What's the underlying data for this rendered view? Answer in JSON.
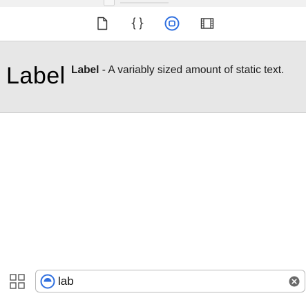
{
  "header": {
    "tabs": [
      {
        "name": "file-inspector",
        "icon": "file-icon",
        "selected": false
      },
      {
        "name": "code-snippet-library",
        "icon": "braces-icon",
        "selected": false
      },
      {
        "name": "object-library",
        "icon": "object-library-icon",
        "selected": true
      },
      {
        "name": "media-library",
        "icon": "film-strip-icon",
        "selected": false
      }
    ],
    "accent_color": "#2f6fdf",
    "icon_color": "#333333"
  },
  "library": {
    "items": [
      {
        "preview_text": "Label",
        "title": "Label",
        "description": " - A variably sized amount of static text."
      }
    ],
    "selected_background": "#e7e7e7"
  },
  "filter_bar": {
    "view_toggle_icon": "grid-view-icon",
    "filter_icon": "object-filter-icon",
    "value": "lab",
    "clear_icon": "clear-circle-icon"
  }
}
